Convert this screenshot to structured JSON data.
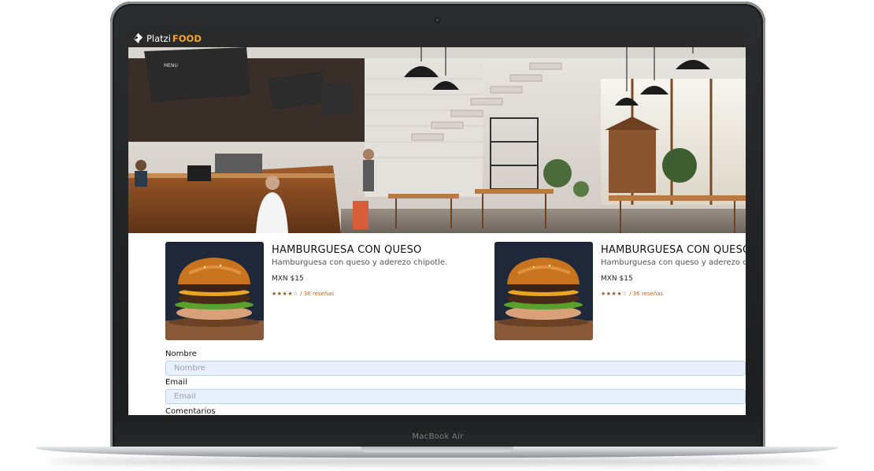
{
  "device": {
    "label": "MacBook Air"
  },
  "header": {
    "logo_word": "Platzi",
    "logo_accent": "FOOD",
    "accent_color": "#f5a623"
  },
  "products": [
    {
      "title": "HAMBURGUESA CON QUESO",
      "description": "Hamburguesa con queso y aderezo chipotle.",
      "price": "MXN $15",
      "stars": "★★★★☆",
      "reviews": " / 36 reseñas"
    },
    {
      "title": "HAMBURGUESA CON QUESO",
      "description": "Hamburguesa con queso y aderezo chipotle.",
      "price": "MXN $15",
      "stars": "★★★★☆",
      "reviews": " / 36 reseñas"
    }
  ],
  "form": {
    "name_label": "Nombre",
    "name_placeholder": "Nombre",
    "email_label": "Email",
    "email_placeholder": "Email",
    "comments_label": "Comentarios"
  }
}
